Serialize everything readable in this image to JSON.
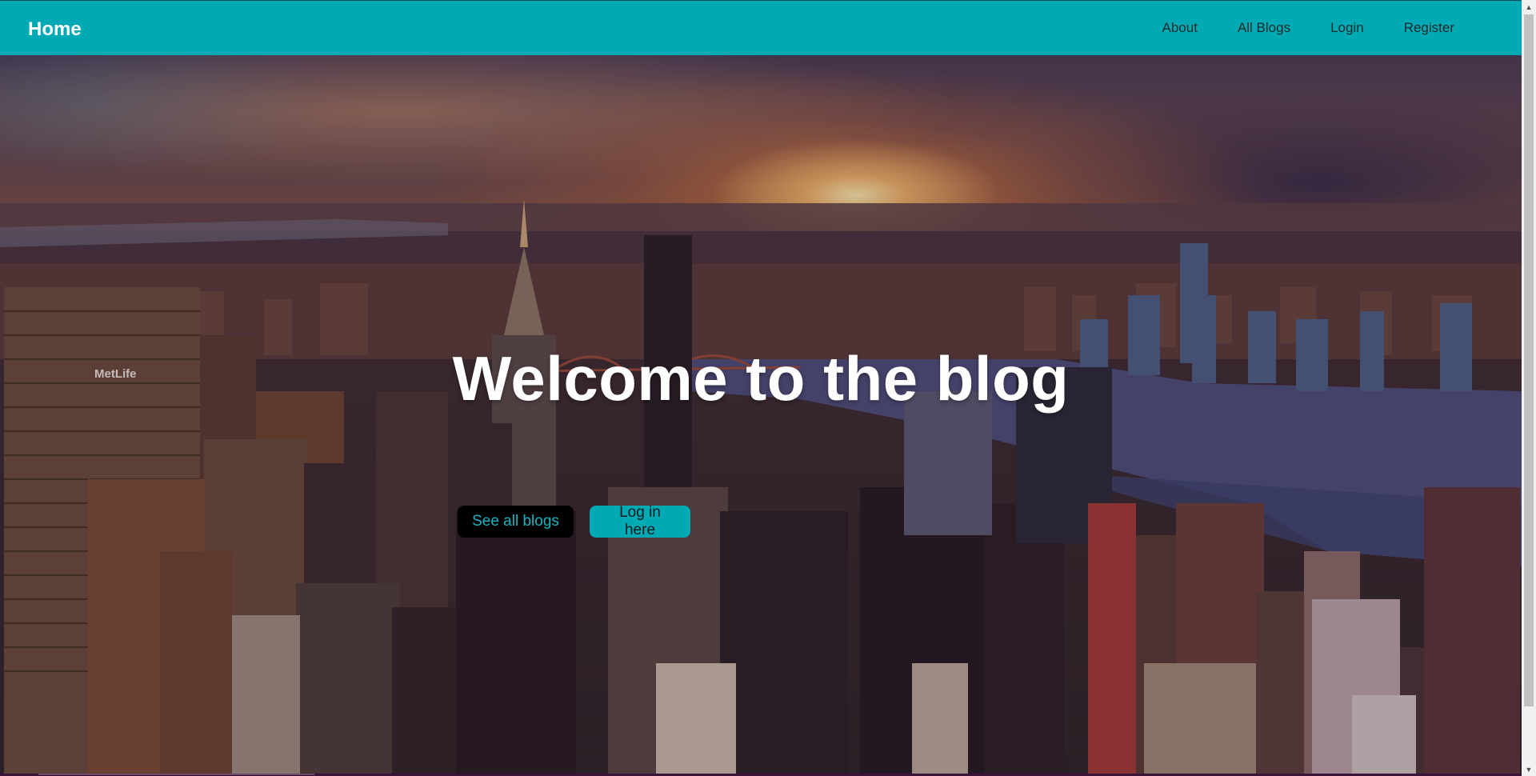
{
  "navbar": {
    "brand": "Home",
    "links": [
      {
        "label": "About"
      },
      {
        "label": "All Blogs"
      },
      {
        "label": "Login"
      },
      {
        "label": "Register"
      }
    ],
    "background_color": "#00aab5"
  },
  "hero": {
    "title": "Welcome to the blog",
    "buttons": {
      "primary": "See all blogs",
      "secondary": "Log in here"
    },
    "background_image": "city-skyline-sunset",
    "sign_text": "MetLife"
  },
  "colors": {
    "accent": "#00aab5",
    "dark_button": "#000000",
    "title_text": "#ffffff"
  }
}
